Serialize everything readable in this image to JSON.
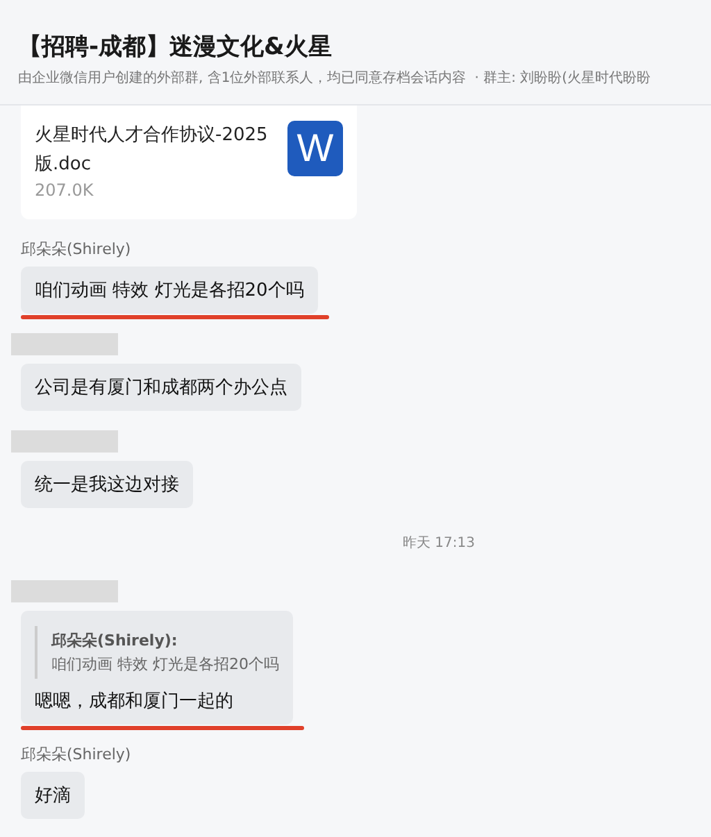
{
  "header": {
    "title": "【招聘-成都】迷漫文化&火星",
    "description": "由企业微信用户创建的外部群, 含1位外部联系人，均已同意存档会话内容",
    "owner": "· 群主: 刘盼盼(火星时代盼盼"
  },
  "messages": [
    {
      "kind": "file",
      "file_name": "火星时代人才合作协议-2025版.doc",
      "file_size": "207.0K",
      "file_icon": "W"
    },
    {
      "kind": "text",
      "sender": "邱朵朵(Shirely)",
      "text": "咱们动画 特效 灯光是各招20个吗",
      "underlined": true
    },
    {
      "kind": "text",
      "sender_redacted": true,
      "text": "公司是有厦门和成都两个办公点",
      "underlined": false
    },
    {
      "kind": "text",
      "sender_redacted": true,
      "text": "统一是我这边对接",
      "underlined": false
    },
    {
      "kind": "time",
      "text": "昨天 17:13"
    },
    {
      "kind": "text",
      "sender_redacted": true,
      "quote": {
        "author": "邱朵朵(Shirely):",
        "text": "咱们动画 特效 灯光是各招20个吗"
      },
      "text": "嗯嗯，成都和厦门一起的",
      "underlined": true
    },
    {
      "kind": "text",
      "sender": "邱朵朵(Shirely)",
      "text": "好滴",
      "underlined": false
    }
  ]
}
